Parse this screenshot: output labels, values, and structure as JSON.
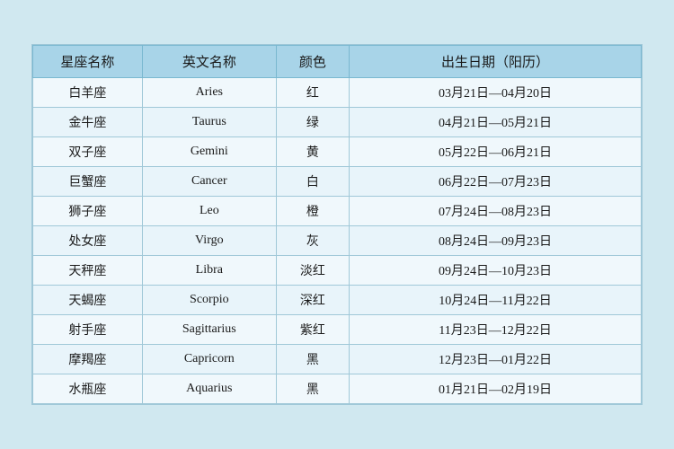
{
  "table": {
    "headers": {
      "zh_name": "星座名称",
      "en_name": "英文名称",
      "color": "颜色",
      "date": "出生日期（阳历）"
    },
    "rows": [
      {
        "zh": "白羊座",
        "en": "Aries",
        "color": "红",
        "date": "03月21日—04月20日"
      },
      {
        "zh": "金牛座",
        "en": "Taurus",
        "color": "绿",
        "date": "04月21日—05月21日"
      },
      {
        "zh": "双子座",
        "en": "Gemini",
        "color": "黄",
        "date": "05月22日—06月21日"
      },
      {
        "zh": "巨蟹座",
        "en": "Cancer",
        "color": "白",
        "date": "06月22日—07月23日"
      },
      {
        "zh": "狮子座",
        "en": "Leo",
        "color": "橙",
        "date": "07月24日—08月23日"
      },
      {
        "zh": "处女座",
        "en": "Virgo",
        "color": "灰",
        "date": "08月24日—09月23日"
      },
      {
        "zh": "天秤座",
        "en": "Libra",
        "color": "淡红",
        "date": "09月24日—10月23日"
      },
      {
        "zh": "天蝎座",
        "en": "Scorpio",
        "color": "深红",
        "date": "10月24日—11月22日"
      },
      {
        "zh": "射手座",
        "en": "Sagittarius",
        "color": "紫红",
        "date": "11月23日—12月22日"
      },
      {
        "zh": "摩羯座",
        "en": "Capricorn",
        "color": "黑",
        "date": "12月23日—01月22日"
      },
      {
        "zh": "水瓶座",
        "en": "Aquarius",
        "color": "黑",
        "date": "01月21日—02月19日"
      }
    ]
  }
}
